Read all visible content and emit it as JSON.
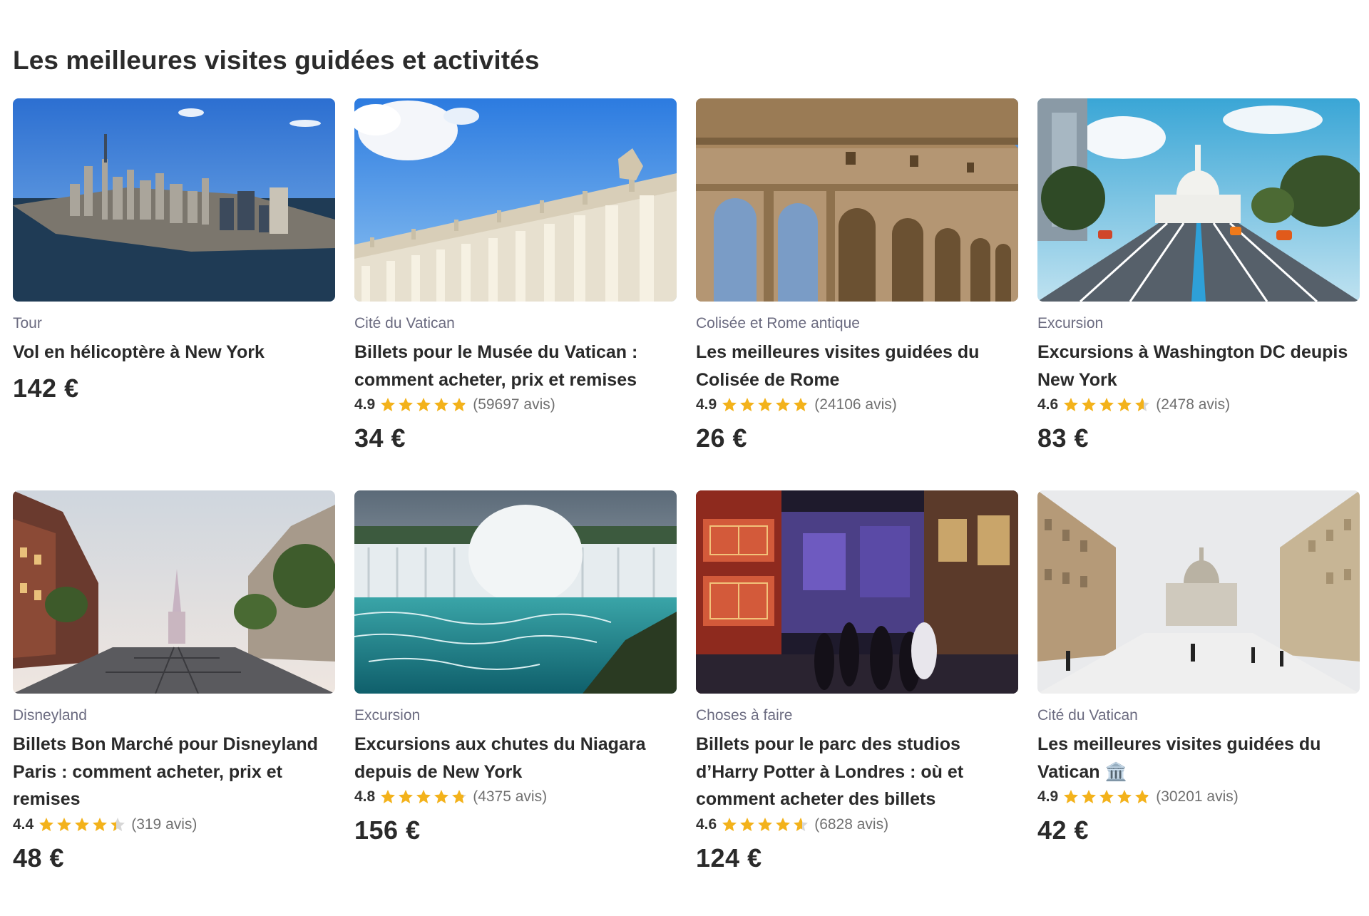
{
  "section": {
    "title": "Les meilleures visites guidées et activités"
  },
  "colors": {
    "star": "#f3b21b",
    "star_empty": "#d7d7d7",
    "category": "#6b6b80",
    "text": "#2a2a2a"
  },
  "cards": [
    {
      "category": "Tour",
      "title": "Vol en hélicoptère à New York",
      "rating": null,
      "reviews": null,
      "stars": null,
      "price": "142 €",
      "image": "new-york-skyline-aerial"
    },
    {
      "category": "Cité du Vatican",
      "title": "Billets pour le Musée du Vatican : comment acheter, prix et remises",
      "rating": "4.9",
      "stars": 4.9,
      "reviews": "(59697 avis)",
      "price": "34 €",
      "image": "vatican-colonnade"
    },
    {
      "category": "Colisée et Rome antique",
      "title": "Les meilleures visites guidées du Colisée de Rome",
      "rating": "4.9",
      "stars": 4.9,
      "reviews": "(24106 avis)",
      "price": "26 €",
      "image": "colosseum-arches"
    },
    {
      "category": "Excursion",
      "title": "Excursions à Washington DC deupis New York",
      "rating": "4.6",
      "stars": 4.6,
      "reviews": "(2478 avis)",
      "price": "83 €",
      "image": "washington-capitol-avenue"
    },
    {
      "category": "Disneyland",
      "title": "Billets Bon Marché pour Disneyland Paris : comment acheter, prix et remises",
      "rating": "4.4",
      "stars": 4.4,
      "reviews": "(319 avis)",
      "price": "48 €",
      "image": "disneyland-main-street"
    },
    {
      "category": "Excursion",
      "title": "Excursions aux chutes du Niagara depuis de New York",
      "rating": "4.8",
      "stars": 4.8,
      "reviews": "(4375 avis)",
      "price": "156 €",
      "image": "niagara-falls"
    },
    {
      "category": "Choses à faire",
      "title": "Billets pour le parc des studios d’Harry Potter à Londres : où et comment acheter des billets",
      "rating": "4.6",
      "stars": 4.6,
      "reviews": "(6828 avis)",
      "price": "124 €",
      "image": "harry-potter-diagon-alley"
    },
    {
      "category": "Cité du Vatican",
      "title": "Les meilleures visites guidées du Vatican 🏛️",
      "rating": "4.9",
      "stars": 4.9,
      "reviews": "(30201 avis)",
      "price": "42 €",
      "image": "via-della-conciliazione-st-peters"
    }
  ]
}
